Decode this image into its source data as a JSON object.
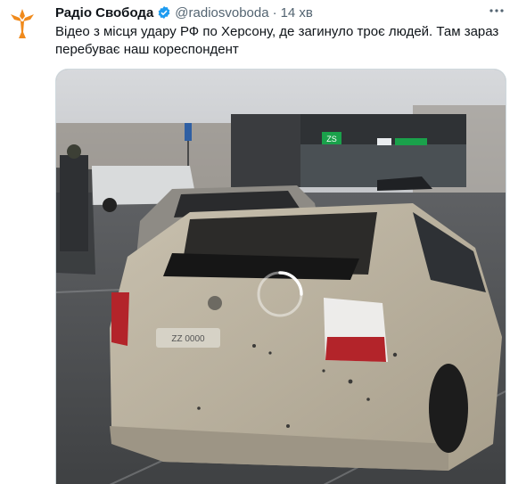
{
  "tweet": {
    "author_name": "Радіо Свобода",
    "handle": "@radiosvoboda",
    "separator": "·",
    "time": "14 хв",
    "text": "Відео з місця удару РФ по Херсону, де загинуло троє людей. Там зараз перебуває наш кореспондент"
  },
  "media": {
    "plate_text": "ZZ 0000",
    "store_sign": "ZS"
  },
  "icons": {
    "avatar": "radio-svoboda-logo-icon",
    "verified": "verified-badge-icon",
    "more": "more-options-icon",
    "loading": "loading-spinner-icon"
  },
  "colors": {
    "brand_orange": "#f08a1c",
    "verified_blue": "#1d9bf0",
    "store_green": "#1aa14b"
  }
}
